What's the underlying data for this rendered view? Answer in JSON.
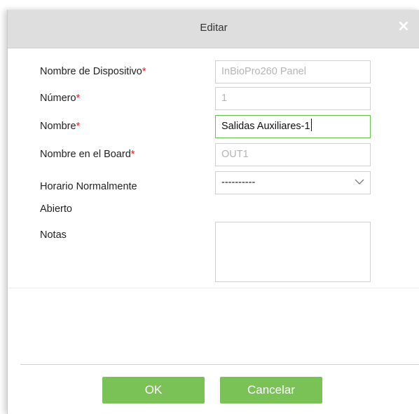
{
  "dialog": {
    "title": "Editar",
    "close_glyph": "×"
  },
  "form": {
    "device_name": {
      "label": "Nombre de Dispositivo",
      "required": "*",
      "value": "InBioPro260 Panel"
    },
    "number": {
      "label": "Número",
      "required": "*",
      "value": "1"
    },
    "name": {
      "label": "Nombre",
      "required": "*",
      "value": "Salidas Auxiliares-1"
    },
    "board_name": {
      "label": "Nombre en el Board",
      "required": "*",
      "value": "OUT1"
    },
    "schedule": {
      "label_line1": "Horario Normalmente",
      "label_line2": "Abierto",
      "value": "----------"
    },
    "notes": {
      "label": "Notas",
      "value": ""
    }
  },
  "buttons": {
    "ok": "OK",
    "cancel": "Cancelar"
  },
  "colors": {
    "accent": "#7ac256",
    "active_border": "#6bbf4e",
    "required": "#e02020",
    "titlebar": "#dedede"
  },
  "icons": {
    "close": "close-icon",
    "dropdown": "chevron-down-icon"
  }
}
